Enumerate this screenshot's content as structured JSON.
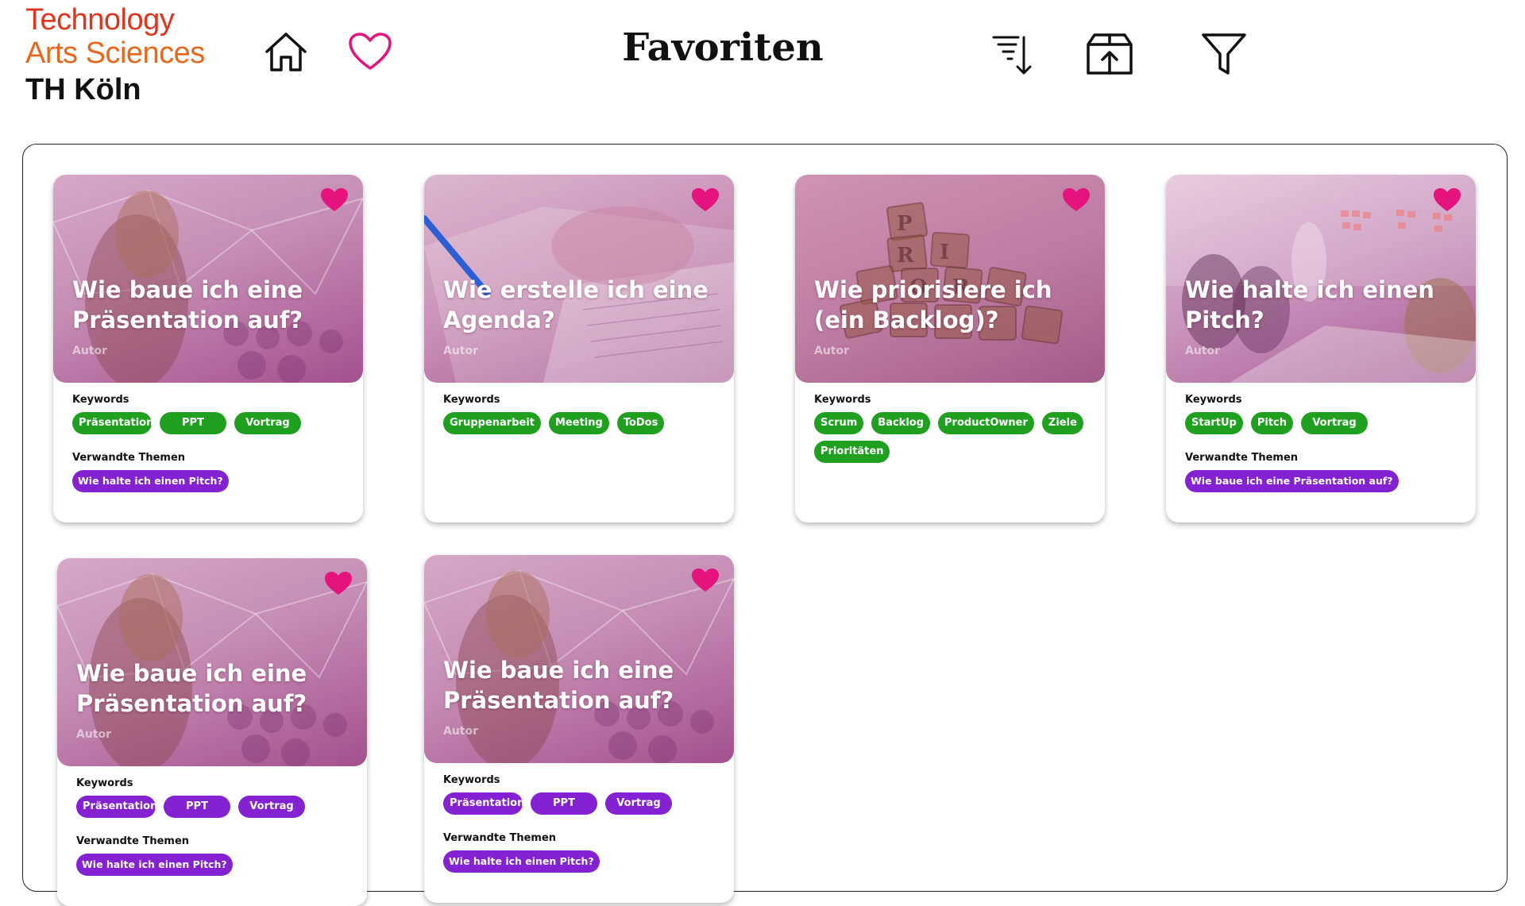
{
  "logo": {
    "line1": "Technology",
    "line2": "Arts Sciences",
    "line3": "TH Köln",
    "colors": {
      "line1": "#e0341e",
      "line2": "#e8671c",
      "line3": "#111111"
    }
  },
  "header": {
    "title": "Favoriten",
    "icons": [
      "home-icon",
      "heart-outline-icon",
      "sort-descending-icon",
      "export-box-icon",
      "filter-icon"
    ]
  },
  "colors": {
    "accent_heart": "#e5137d",
    "keyword_green": "#1fa01f",
    "keyword_purple": "#8421d2",
    "related_purple": "#8421d2"
  },
  "labels": {
    "keywords": "Keywords",
    "related": "Verwandte Themen"
  },
  "cards": [
    {
      "title": "Wie baue ich eine Präsentation auf?",
      "author": "Autor",
      "image": "presentation-speaker",
      "keywords": [
        "Präsentation",
        "PPT",
        "Vortrag"
      ],
      "keyword_color": "green",
      "related": [
        "Wie halte ich einen Pitch?"
      ]
    },
    {
      "title": "Wie erstelle ich eine Agenda?",
      "author": "Autor",
      "image": "writing-agenda",
      "keywords": [
        "Gruppenarbeit",
        "Meeting",
        "ToDos"
      ],
      "keyword_color": "green",
      "related": []
    },
    {
      "title": "Wie priorisiere ich (ein Backlog)?",
      "author": "Autor",
      "image": "scrabble-priority",
      "keywords": [
        "Scrum",
        "Backlog",
        "ProductOwner",
        "Ziele",
        "Prioritäten"
      ],
      "keyword_color": "green",
      "related": []
    },
    {
      "title": "Wie halte ich einen Pitch?",
      "author": "Autor",
      "image": "pitch-meeting",
      "keywords": [
        "StartUp",
        "Pitch",
        "Vortrag"
      ],
      "keyword_color": "green",
      "related": [
        "Wie baue ich eine Präsentation auf?"
      ]
    },
    {
      "title": "Wie baue ich eine Präsentation auf?",
      "author": "Autor",
      "image": "presentation-speaker",
      "keywords": [
        "Präsentation",
        "PPT",
        "Vortrag"
      ],
      "keyword_color": "purple",
      "related": [
        "Wie halte ich einen Pitch?"
      ]
    },
    {
      "title": "Wie baue ich eine Präsentation auf?",
      "author": "Autor",
      "image": "presentation-speaker",
      "keywords": [
        "Präsentation",
        "PPT",
        "Vortrag"
      ],
      "keyword_color": "purple",
      "related": [
        "Wie halte ich einen Pitch?"
      ]
    }
  ]
}
